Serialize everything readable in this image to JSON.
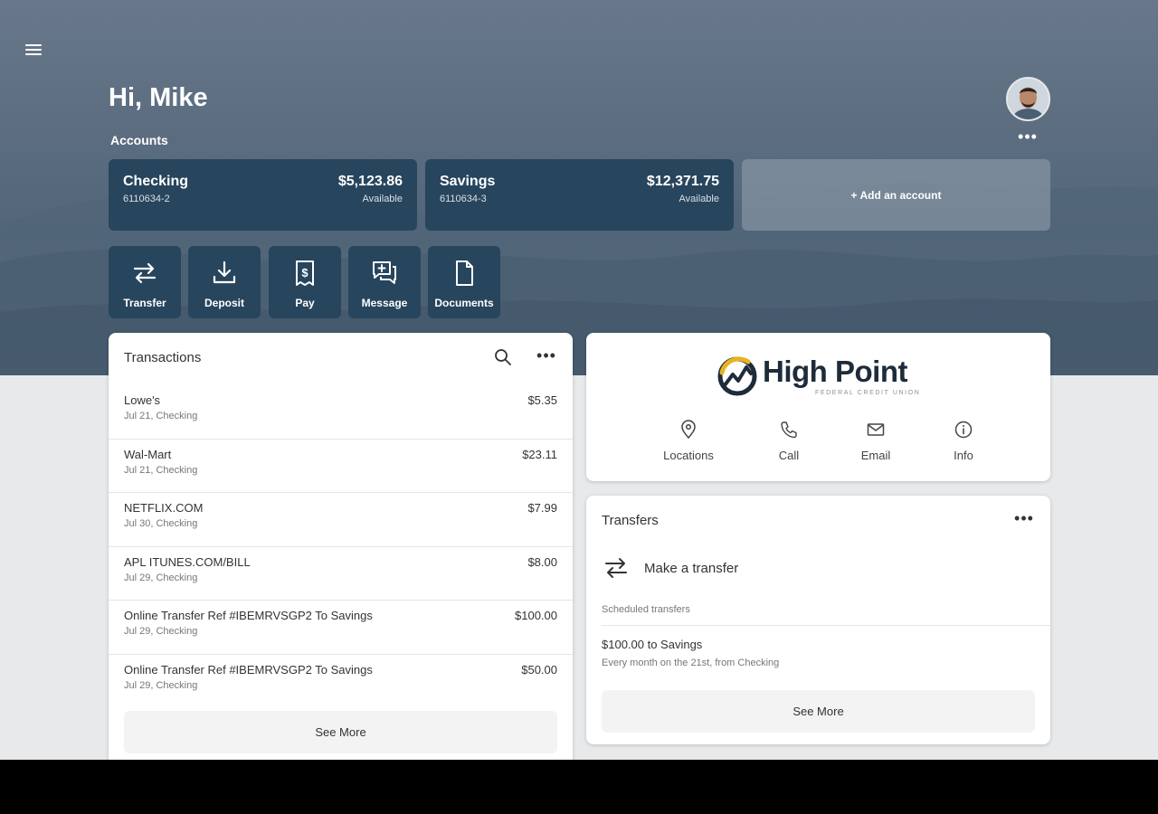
{
  "header": {
    "greeting": "Hi, Mike",
    "accounts_label": "Accounts"
  },
  "accounts": [
    {
      "name": "Checking",
      "number": "6110634-2",
      "balance": "$5,123.86",
      "status": "Available"
    },
    {
      "name": "Savings",
      "number": "6110634-3",
      "balance": "$12,371.75",
      "status": "Available"
    }
  ],
  "add_account_label": "+ Add an account",
  "actions": [
    {
      "label": "Transfer",
      "icon": "transfer-icon"
    },
    {
      "label": "Deposit",
      "icon": "deposit-icon"
    },
    {
      "label": "Pay",
      "icon": "pay-icon"
    },
    {
      "label": "Message",
      "icon": "message-icon"
    },
    {
      "label": "Documents",
      "icon": "documents-icon"
    }
  ],
  "transactions": {
    "title": "Transactions",
    "items": [
      {
        "name": "Lowe's",
        "detail": "Jul 21, Checking",
        "amount": "$5.35"
      },
      {
        "name": "Wal-Mart",
        "detail": "Jul 21, Checking",
        "amount": "$23.11"
      },
      {
        "name": "NETFLIX.COM",
        "detail": "Jul 30, Checking",
        "amount": "$7.99"
      },
      {
        "name": "APL ITUNES.COM/BILL",
        "detail": "Jul 29, Checking",
        "amount": "$8.00"
      },
      {
        "name": "Online Transfer Ref #IBEMRVSGP2 To Savings",
        "detail": "Jul 29, Checking",
        "amount": "$100.00"
      },
      {
        "name": "Online Transfer Ref #IBEMRVSGP2 To Savings",
        "detail": "Jul 29, Checking",
        "amount": "$50.00"
      }
    ],
    "see_more": "See More"
  },
  "brand": {
    "name": "High Point",
    "subtitle": "FEDERAL CREDIT UNION",
    "actions": [
      {
        "label": "Locations",
        "icon": "location-pin-icon"
      },
      {
        "label": "Call",
        "icon": "phone-icon"
      },
      {
        "label": "Email",
        "icon": "email-icon"
      },
      {
        "label": "Info",
        "icon": "info-icon"
      }
    ]
  },
  "transfers": {
    "title": "Transfers",
    "make_transfer": "Make a transfer",
    "scheduled_label": "Scheduled transfers",
    "scheduled": [
      {
        "title": "$100.00 to Savings",
        "detail": "Every month on the 21st, from Checking"
      }
    ],
    "see_more": "See More"
  },
  "colors": {
    "card_navy": "#27455d",
    "hero_slate": "#5c6d80",
    "logo_gold": "#e9b31f",
    "logo_navy": "#1e2b3a"
  }
}
